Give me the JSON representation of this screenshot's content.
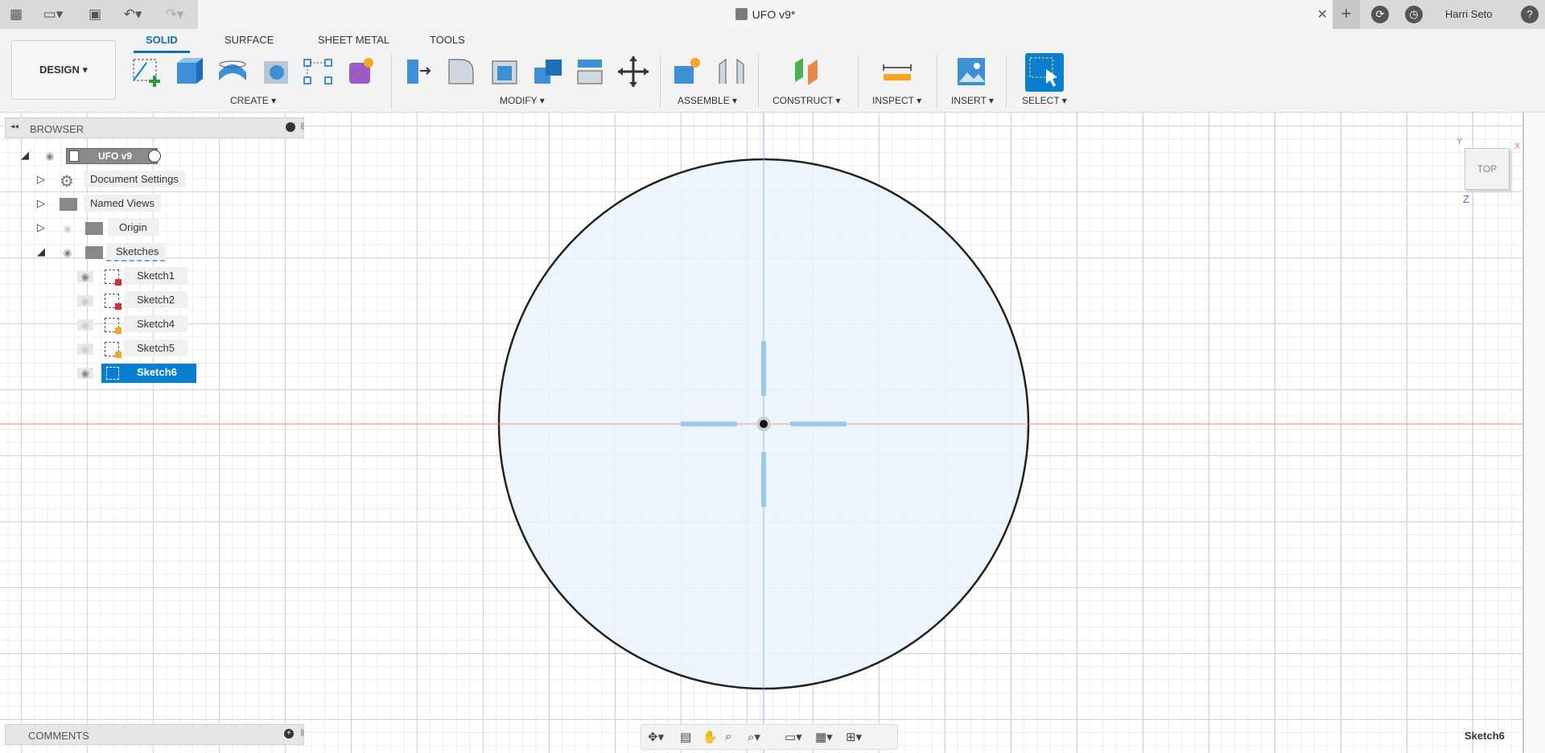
{
  "window": {
    "document_title": "UFO v9*",
    "user_name": "Harri Seto"
  },
  "toolbar": {
    "design_label": "DESIGN ▾",
    "tabs": [
      {
        "label": "SOLID"
      },
      {
        "label": "SURFACE"
      },
      {
        "label": "SHEET METAL"
      },
      {
        "label": "TOOLS"
      }
    ],
    "groups": {
      "create": "CREATE ▾",
      "modify": "MODIFY ▾",
      "assemble": "ASSEMBLE ▾",
      "construct": "CONSTRUCT ▾",
      "inspect": "INSPECT ▾",
      "insert": "INSERT ▾",
      "select": "SELECT ▾"
    }
  },
  "browser": {
    "title": "BROWSER",
    "root": "UFO v9",
    "items": [
      {
        "label": "Document Settings"
      },
      {
        "label": "Named Views"
      },
      {
        "label": "Origin"
      },
      {
        "label": "Sketches"
      }
    ],
    "sketches": [
      {
        "label": "Sketch1"
      },
      {
        "label": "Sketch2"
      },
      {
        "label": "Sketch4"
      },
      {
        "label": "Sketch5"
      },
      {
        "label": "Sketch6"
      }
    ]
  },
  "comments": {
    "title": "COMMENTS"
  },
  "viewcube": {
    "face": "TOP",
    "axis_x": "X",
    "axis_y": "Y",
    "axis_z": "Z"
  },
  "status": {
    "active_sketch": "Sketch6"
  },
  "colors": {
    "accent": "#0a7ed0",
    "sketch_fill": "#eaf4fc",
    "axis_red": "#f08080",
    "axis_blue": "#8fa6ff"
  }
}
